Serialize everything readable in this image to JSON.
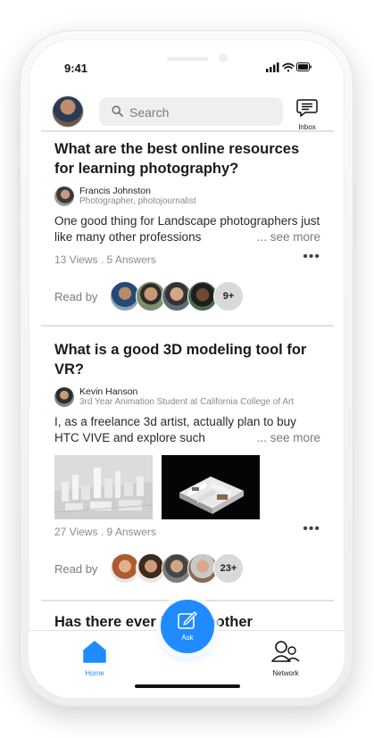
{
  "status_bar": {
    "time": "9:41"
  },
  "header": {
    "search_placeholder": "Search",
    "inbox_label": "Inbox"
  },
  "feed": [
    {
      "question": "What are the best online resources for learning photography?",
      "author_name": "Francis Johnston",
      "author_role": "Photographer, photojournalist",
      "excerpt": "One good thing for Landscape photographers just like many other professions",
      "see_more": "... see more",
      "views": "13 Views",
      "answers": "5 Answers",
      "read_by_label": "Read by",
      "read_by_more": "9+"
    },
    {
      "question": "What is a good 3D modeling tool for VR?",
      "author_name": "Kevin Hanson",
      "author_role": "3rd Year Animation Student at California College of Art",
      "excerpt": "I, as a freelance 3d artist, actually plan to buy HTC VIVE and explore such",
      "see_more": "... see more",
      "views": "27 Views",
      "answers": "9 Answers",
      "read_by_label": "Read by",
      "read_by_more": "23+"
    },
    {
      "question": "Has there ever been another"
    }
  ],
  "bottom_nav": {
    "home": "Home",
    "ask": "Ask",
    "network": "Network"
  },
  "colors": {
    "accent": "#1f8bff",
    "text": "#1a1a1a",
    "muted": "#8a8a8a"
  },
  "icons": [
    "search-icon",
    "inbox-icon",
    "more-icon",
    "home-icon",
    "ask-icon",
    "network-icon",
    "signal-icon",
    "wifi-icon",
    "battery-icon"
  ]
}
